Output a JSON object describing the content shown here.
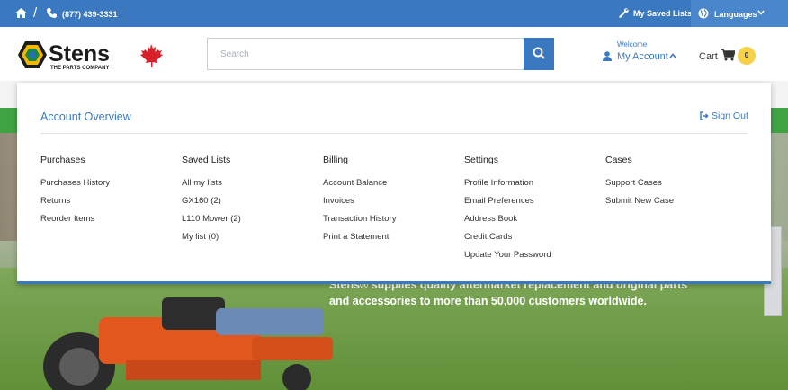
{
  "topbar": {
    "home_icon": "home-icon",
    "phone_icon": "phone-icon",
    "phone": "(877) 439-3331",
    "wrench_icon": "wrench-icon",
    "saved_lists": "My Saved Lists",
    "globe_icon": "globe-icon",
    "languages": "Languages"
  },
  "header": {
    "logo_text": "Stens",
    "logo_tagline": "THE PARTS COMPANY",
    "search_placeholder": "Search",
    "welcome": "Welcome",
    "account": "My Account",
    "cart": "Cart",
    "cart_count": "0"
  },
  "hero": {
    "text": "Stens® supplies quality aftermarket replacement and original parts and accessories to more than 50,000 customers worldwide."
  },
  "panel": {
    "title": "Account Overview",
    "sign_out": "Sign Out",
    "columns": [
      {
        "heading": "Purchases",
        "items": [
          "Purchases History",
          "Returns",
          "Reorder Items"
        ]
      },
      {
        "heading": "Saved Lists",
        "items": [
          "All my lists",
          "GX160 (2)",
          "L110 Mower (2)",
          "My list (0)"
        ]
      },
      {
        "heading": "Billing",
        "items": [
          "Account Balance",
          "Invoices",
          "Transaction History",
          "Print a Statement"
        ]
      },
      {
        "heading": "Settings",
        "items": [
          "Profile Information",
          "Email Preferences",
          "Address Book",
          "Credit Cards",
          "Update Your Password"
        ]
      },
      {
        "heading": "Cases",
        "items": [
          "Support Cases",
          "Submit New Case"
        ]
      }
    ]
  },
  "colors": {
    "accent": "#3a78c0",
    "nav_green": "#3fa344",
    "badge": "#f6d24a"
  }
}
